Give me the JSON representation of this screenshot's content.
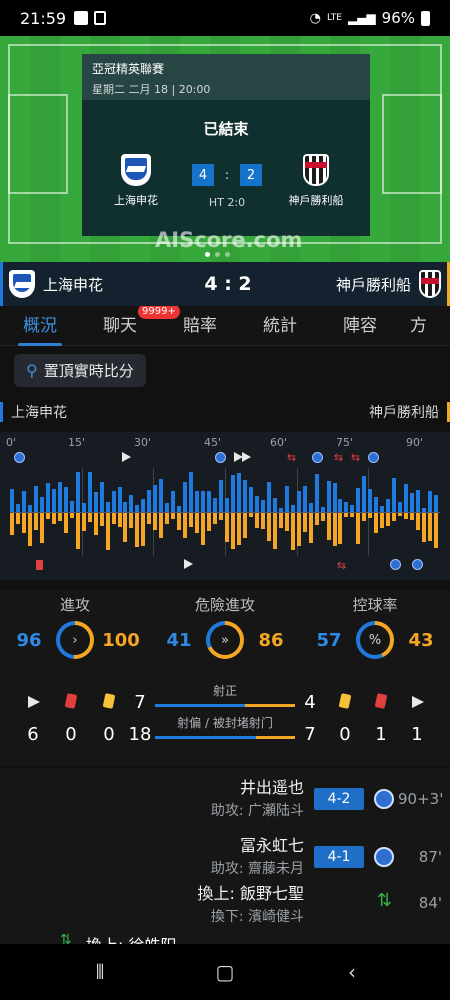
{
  "status_bar": {
    "time": "21:59",
    "battery": "96%",
    "lte": "LTE"
  },
  "match": {
    "league": "亞冠精英聯賽",
    "date": "星期二 二月 18 | 20:00",
    "status": "已結束",
    "home": "上海申花",
    "away": "神戶勝利船",
    "home_score": "4",
    "away_score": "2",
    "score_text": "4 : 2",
    "colon": ":",
    "ht": "HT 2:0",
    "watermark": "AIScore.com"
  },
  "tabs": [
    {
      "label": "概況"
    },
    {
      "label": "聊天",
      "badge": "9999+"
    },
    {
      "label": "賠率"
    },
    {
      "label": "統計"
    },
    {
      "label": "陣容"
    },
    {
      "label": "方案"
    }
  ],
  "pin_button": "置頂實時比分",
  "teams_row": {
    "home": "上海申花",
    "away": "神戶勝利船"
  },
  "timeline": {
    "minutes": [
      "0'",
      "15'",
      "30'",
      "45'",
      "60'",
      "75'",
      "90'"
    ]
  },
  "stats": {
    "attack": {
      "label": "進攻",
      "home": "96",
      "away": "100",
      "icon": "›"
    },
    "dangerous": {
      "label": "危險進攻",
      "home": "41",
      "away": "86",
      "icon": "»"
    },
    "possession": {
      "label": "控球率",
      "home": "57",
      "away": "43",
      "icon": "%"
    },
    "home_corners": "6",
    "home_red": "0",
    "home_yellow": "0",
    "away_corners": "1",
    "away_red": "1",
    "away_yellow": "0",
    "shots_on": {
      "label": "射正",
      "home": "7",
      "away": "4"
    },
    "shots_off": {
      "label": "射偏 / 被封堵射门",
      "home": "18",
      "away": "7"
    }
  },
  "events": [
    {
      "player": "井出遥也",
      "assist": "助攻: 广瀬陆斗",
      "score": "4-2",
      "minute": "90+3'"
    },
    {
      "player": "冨永虹七",
      "assist": "助攻: 齋藤未月",
      "score": "4-1",
      "minute": "87'"
    },
    {
      "player": "換上: 飯野七聖",
      "assist": "換下: 濱崎健斗",
      "minute": "84'"
    },
    {
      "player": "換上: 徐皓阳"
    }
  ]
}
